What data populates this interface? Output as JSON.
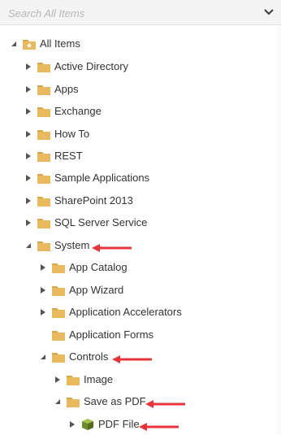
{
  "search": {
    "placeholder": "Search All Items",
    "value": ""
  },
  "icons": {
    "dropdown": "chevron-down-icon",
    "expanded": "expanded-triangle-icon",
    "collapsed": "collapsed-triangle-icon",
    "folder": "folder-icon",
    "root_folder": "folder-star-icon",
    "cube": "cube-icon",
    "pointer": "red-arrow-icon"
  },
  "colors": {
    "folder": "#e9b95f",
    "folder_tab": "#d9a547",
    "cube": "#6f8a2a",
    "pointer": "#e8333a"
  },
  "tree": {
    "root": {
      "label": "All Items"
    },
    "items": [
      {
        "label": "Active Directory"
      },
      {
        "label": "Apps"
      },
      {
        "label": "Exchange"
      },
      {
        "label": "How To"
      },
      {
        "label": "REST"
      },
      {
        "label": "Sample Applications"
      },
      {
        "label": "SharePoint 2013"
      },
      {
        "label": "SQL Server Service"
      },
      {
        "label": "System"
      },
      {
        "label": "App Catalog"
      },
      {
        "label": "App Wizard"
      },
      {
        "label": "Application Accelerators"
      },
      {
        "label": "Application Forms"
      },
      {
        "label": "Controls"
      },
      {
        "label": "Image"
      },
      {
        "label": "Save as PDF"
      },
      {
        "label": "PDF File"
      }
    ]
  }
}
